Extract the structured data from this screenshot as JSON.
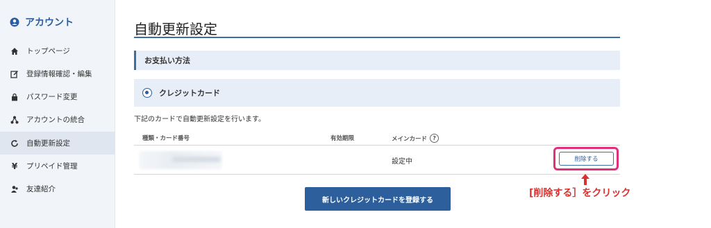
{
  "sidebar": {
    "header": "アカウント",
    "items": [
      {
        "label": "トップページ",
        "icon": "home-icon"
      },
      {
        "label": "登録情報確認・編集",
        "icon": "edit-icon"
      },
      {
        "label": "パスワード変更",
        "icon": "lock-icon"
      },
      {
        "label": "アカウントの統合",
        "icon": "share-nodes-icon"
      },
      {
        "label": "自動更新設定",
        "icon": "refresh-icon",
        "active": true
      },
      {
        "label": "プリペイド管理",
        "icon": "yen-icon"
      },
      {
        "label": "友達紹介",
        "icon": "friends-icon"
      }
    ]
  },
  "main": {
    "title": "自動更新設定",
    "payment_section": "お支払い方法",
    "credit_card_option": "クレジットカード",
    "note": "下記のカードで自動更新設定を行います。",
    "table": {
      "headers": {
        "card": "種類・カード番号",
        "expiry": "有効期限",
        "main_card": "メインカード"
      },
      "rows": [
        {
          "card": "",
          "expiry": "",
          "main_card": "設定中",
          "action": "削除する"
        }
      ]
    },
    "register_button": "新しいクレジットカードを登録する",
    "annotation": "[削除する］をクリック"
  },
  "colors": {
    "accent": "#2c5f9c",
    "highlight": "#e0307b",
    "callout": "#d9322f"
  }
}
